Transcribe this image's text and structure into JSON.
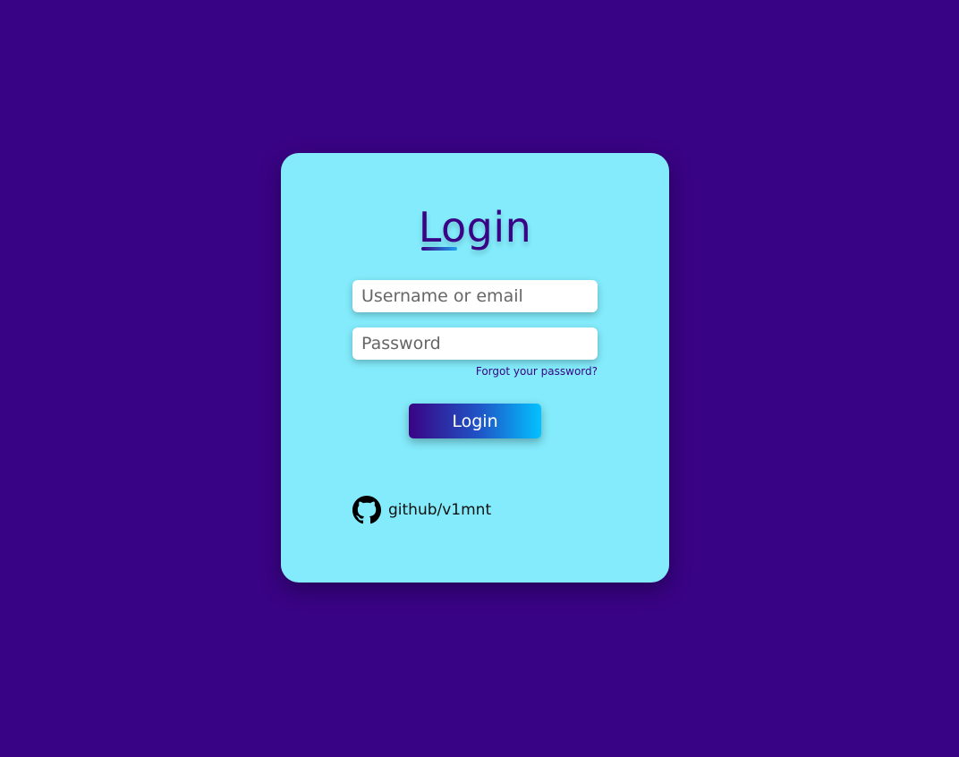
{
  "login_form": {
    "title": "Login",
    "username_placeholder": "Username or email",
    "password_placeholder": "Password",
    "forgot_label": "Forgot your password?",
    "submit_label": "Login"
  },
  "footer": {
    "github_icon": "github-icon",
    "github_label": "github/v1mnt"
  },
  "colors": {
    "background": "#390385",
    "card": "#83ebfb",
    "accent": "#03c2ff"
  }
}
